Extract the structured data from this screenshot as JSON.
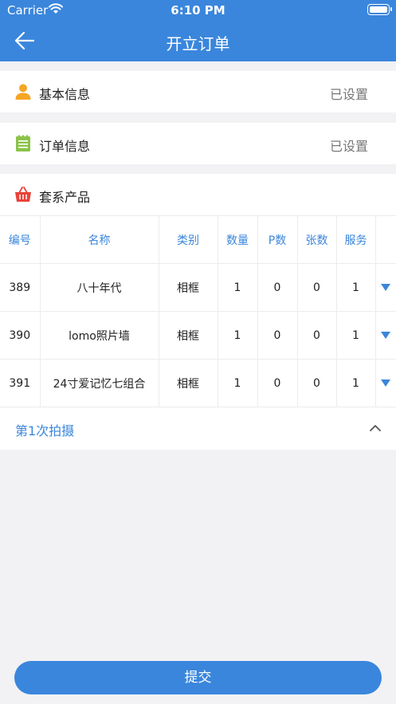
{
  "status_bar": {
    "carrier": "Carrier",
    "time": "6:10 PM"
  },
  "nav": {
    "title": "开立订单",
    "back_icon": "arrow-left-icon"
  },
  "basic_info": {
    "label": "基本信息",
    "value": "已设置",
    "icon": "user-icon",
    "icon_color": "#f5a623"
  },
  "order_info": {
    "label": "订单信息",
    "value": "已设置",
    "icon": "notepad-icon",
    "icon_color": "#8bc34a"
  },
  "products": {
    "label": "套系产品",
    "icon": "basket-icon",
    "icon_color": "#e8433a",
    "columns": [
      "编号",
      "名称",
      "类别",
      "数量",
      "P数",
      "张数",
      "服务"
    ],
    "rows": [
      {
        "id": "389",
        "name": "八十年代",
        "type": "相框",
        "qty": "1",
        "p": "0",
        "sheets": "0",
        "service": "1"
      },
      {
        "id": "390",
        "name": "lomo照片墙",
        "type": "相框",
        "qty": "1",
        "p": "0",
        "sheets": "0",
        "service": "1"
      },
      {
        "id": "391",
        "name": "24寸爱记忆七组合",
        "type": "相框",
        "qty": "1",
        "p": "0",
        "sheets": "0",
        "service": "1"
      }
    ],
    "shoot_label": "第1次拍摄"
  },
  "submit_label": "提交",
  "colors": {
    "accent": "#3a86dc",
    "background": "#f2f2f5"
  }
}
